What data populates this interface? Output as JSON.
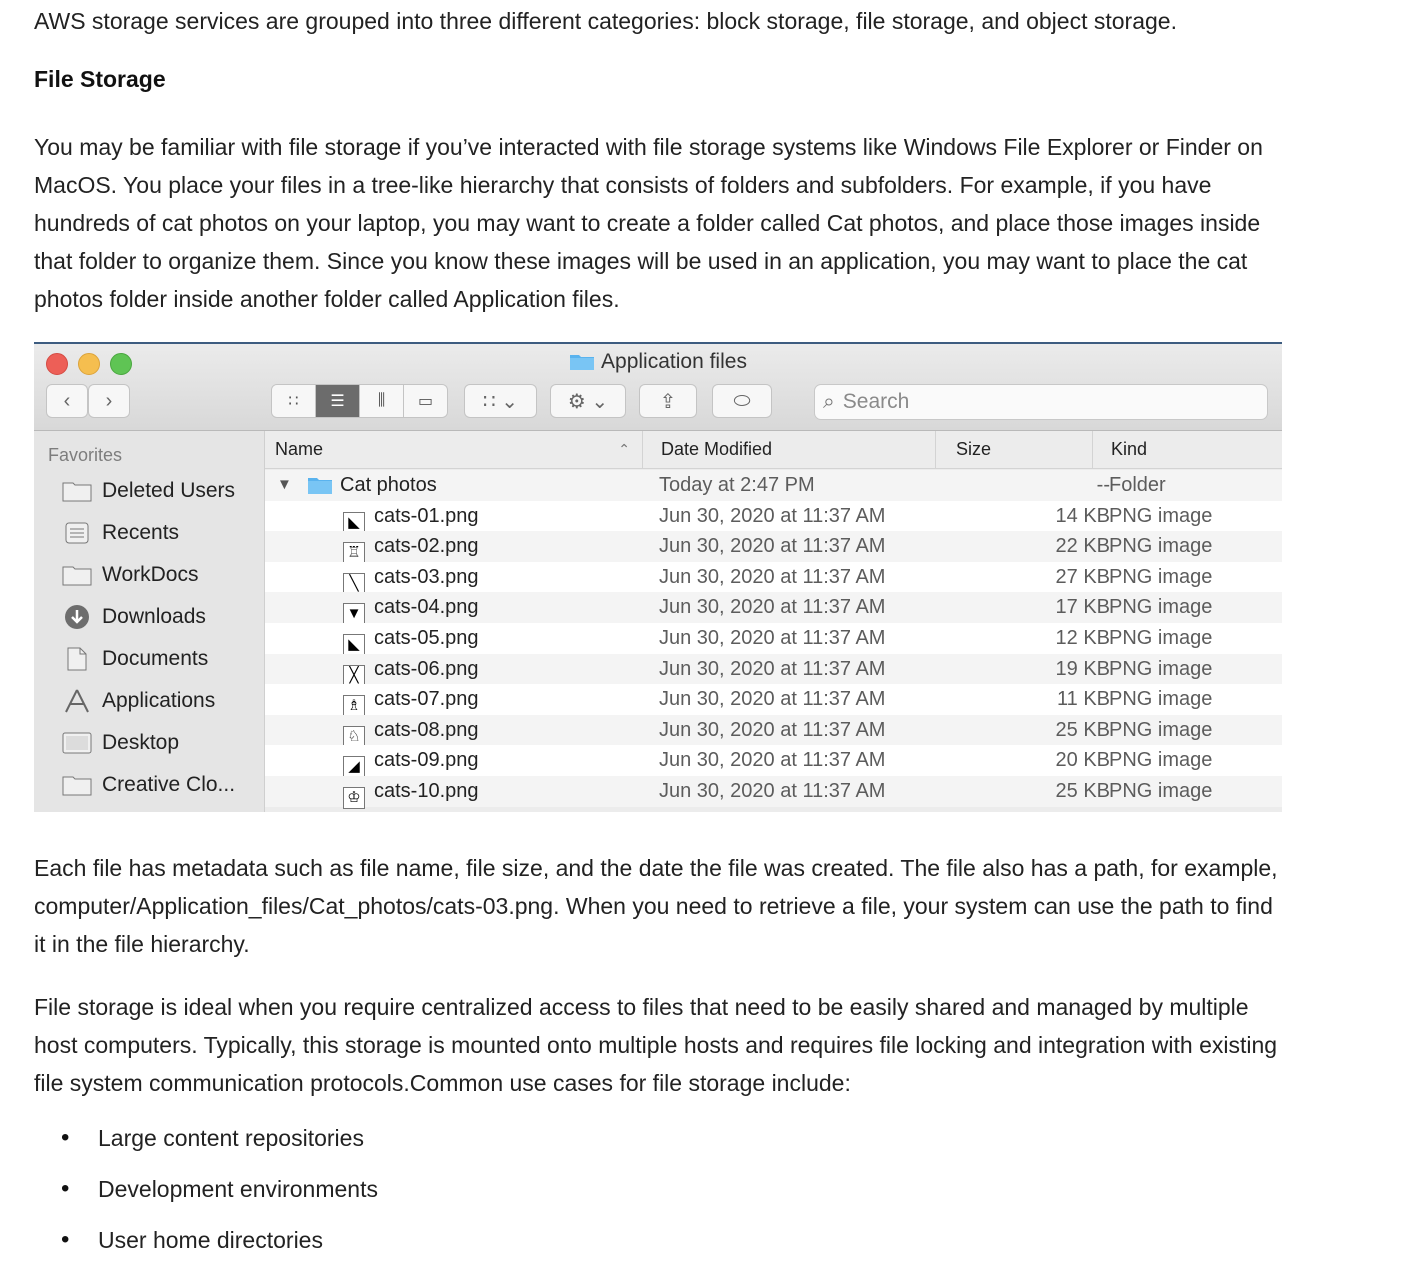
{
  "article": {
    "intro": "AWS storage services are grouped into three different categories: block storage, file storage, and object storage.",
    "heading": "File Storage",
    "para1": "You may be familiar with file storage if you’ve interacted with file storage systems like Windows File Explorer or Finder on MacOS. You place your files in a tree-like hierarchy that consists of folders and subfolders. For example, if you have hundreds of cat photos on your laptop, you may want to create a folder called Cat photos, and place those images inside that folder to organize them. Since you know these images will be used in an application, you may want to place the cat photos folder inside another folder called Application files.",
    "para2": " Each file has metadata such as file name, file size, and the date the file was created. The file also has a path, for example, computer/Application_files/Cat_photos/cats-03.png. When you need to retrieve a file, your system can use the path to find it in the file hierarchy.",
    "para3": "File storage is ideal when you require centralized access to files that need to be easily shared and managed by multiple host computers. Typically, this storage is mounted onto multiple hosts and requires file locking and integration with existing file system communication protocols.Common use cases for file storage include:",
    "bullets": [
      "Large content repositories",
      "Development environments",
      "User home directories"
    ]
  },
  "finder": {
    "title": "Application files",
    "search_placeholder": "Search",
    "favorites_label": "Favorites",
    "sidebar": [
      {
        "label": "Deleted Users",
        "icon": "folder-icon"
      },
      {
        "label": "Recents",
        "icon": "recents-icon"
      },
      {
        "label": "WorkDocs",
        "icon": "folder-icon"
      },
      {
        "label": "Downloads",
        "icon": "downloads-icon"
      },
      {
        "label": "Documents",
        "icon": "documents-icon"
      },
      {
        "label": "Applications",
        "icon": "applications-icon"
      },
      {
        "label": "Desktop",
        "icon": "desktop-icon"
      },
      {
        "label": "Creative Clo...",
        "icon": "folder-icon"
      }
    ],
    "columns": {
      "name": "Name",
      "date": "Date Modified",
      "size": "Size",
      "kind": "Kind"
    },
    "folder_row": {
      "name": "Cat photos",
      "date": "Today at 2:47 PM",
      "size": "--",
      "kind": "Folder"
    },
    "files": [
      {
        "name": "cats-01.png",
        "date": "Jun 30, 2020 at 11:37 AM",
        "size": "14 KB",
        "kind": "PNG image"
      },
      {
        "name": "cats-02.png",
        "date": "Jun 30, 2020 at 11:37 AM",
        "size": "22 KB",
        "kind": "PNG image"
      },
      {
        "name": "cats-03.png",
        "date": "Jun 30, 2020 at 11:37 AM",
        "size": "27 KB",
        "kind": "PNG image"
      },
      {
        "name": "cats-04.png",
        "date": "Jun 30, 2020 at 11:37 AM",
        "size": "17 KB",
        "kind": "PNG image"
      },
      {
        "name": "cats-05.png",
        "date": "Jun 30, 2020 at 11:37 AM",
        "size": "12 KB",
        "kind": "PNG image"
      },
      {
        "name": "cats-06.png",
        "date": "Jun 30, 2020 at 11:37 AM",
        "size": "19 KB",
        "kind": "PNG image"
      },
      {
        "name": "cats-07.png",
        "date": "Jun 30, 2020 at 11:37 AM",
        "size": "11 KB",
        "kind": "PNG image"
      },
      {
        "name": "cats-08.png",
        "date": "Jun 30, 2020 at 11:37 AM",
        "size": "25 KB",
        "kind": "PNG image"
      },
      {
        "name": "cats-09.png",
        "date": "Jun 30, 2020 at 11:37 AM",
        "size": "20 KB",
        "kind": "PNG image"
      },
      {
        "name": "cats-10.png",
        "date": "Jun 30, 2020 at 11:37 AM",
        "size": "25 KB",
        "kind": "PNG image"
      }
    ],
    "colors": {
      "folder": "#5ab3ee",
      "close": "#ed5f57",
      "minimize": "#f5be4f",
      "zoom": "#5fc454",
      "view_active": "#6c6c6c"
    }
  }
}
